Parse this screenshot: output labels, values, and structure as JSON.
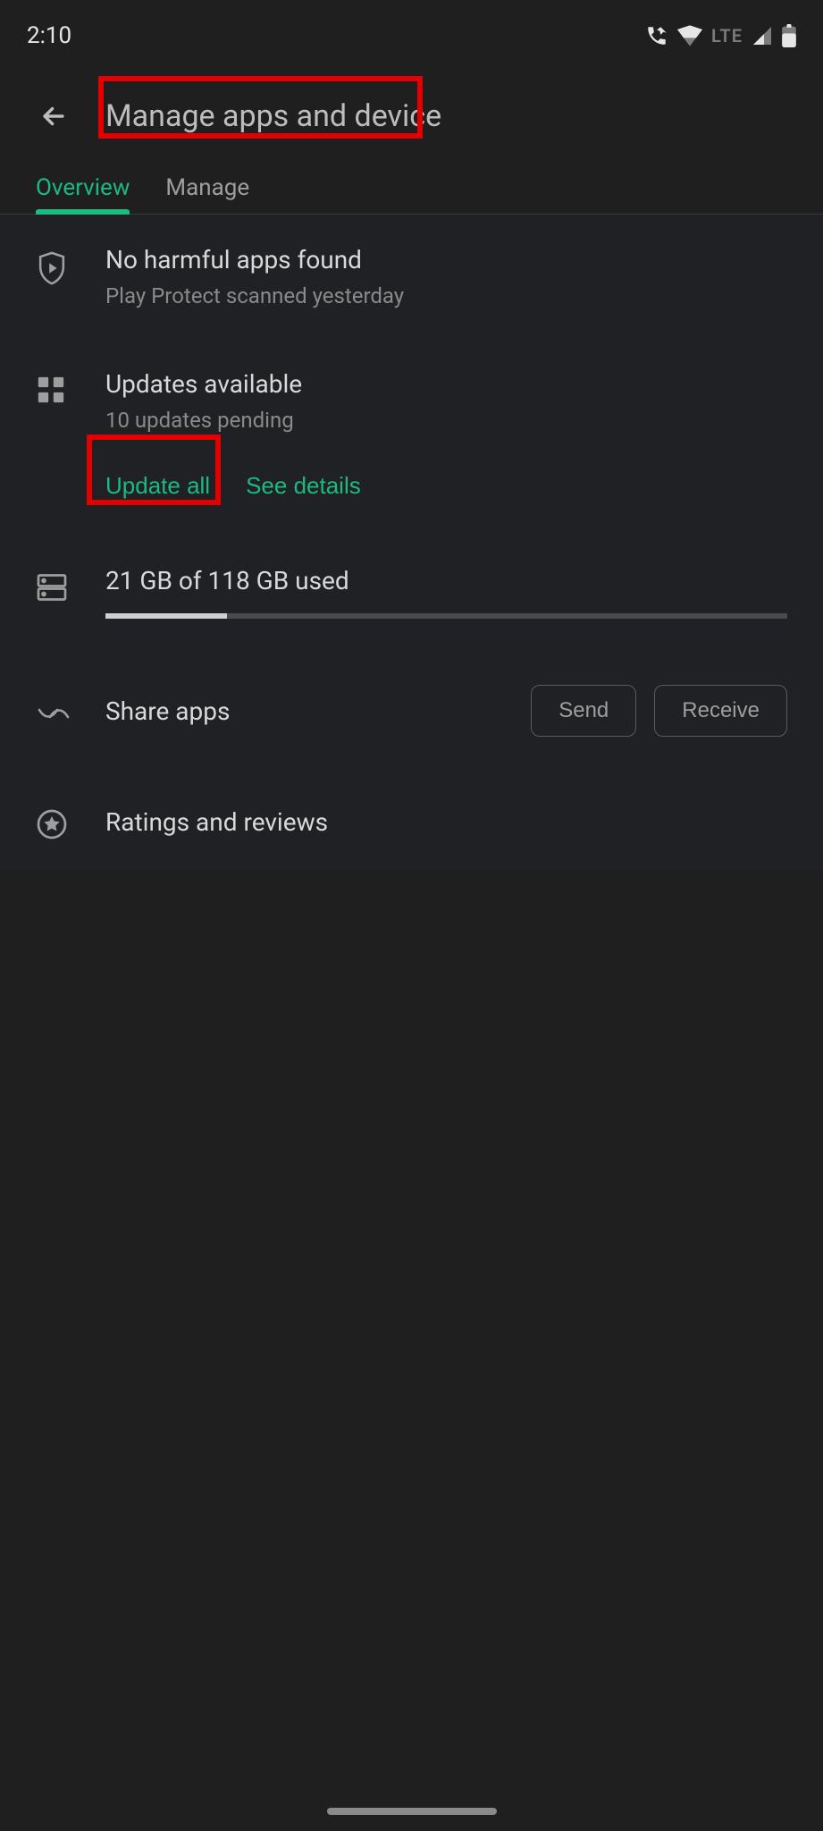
{
  "status": {
    "time": "2:10",
    "network_label": "LTE"
  },
  "header": {
    "title": "Manage apps and device"
  },
  "tabs": {
    "overview": "Overview",
    "manage": "Manage"
  },
  "protect": {
    "title": "No harmful apps found",
    "sub": "Play Protect scanned yesterday"
  },
  "updates": {
    "title": "Updates available",
    "sub": "10 updates pending",
    "update_all": "Update all",
    "see_details": "See details"
  },
  "storage": {
    "title": "21 GB of 118 GB used",
    "used_gb": 21,
    "total_gb": 118
  },
  "share": {
    "title": "Share apps",
    "send": "Send",
    "receive": "Receive"
  },
  "ratings": {
    "title": "Ratings and reviews"
  },
  "colors": {
    "accent": "#1db980",
    "highlight": "#e40000"
  }
}
